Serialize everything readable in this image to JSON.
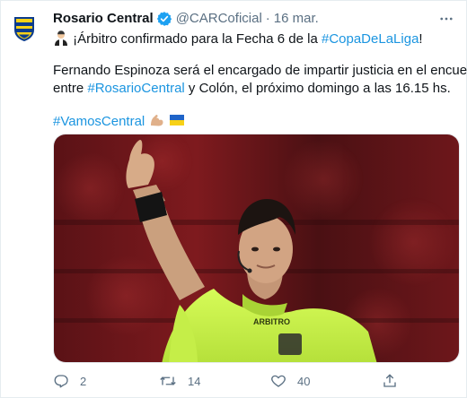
{
  "tweet": {
    "author_name": "Rosario Central",
    "handle": "@CARCoficial",
    "separator": "·",
    "date": "16 mar.",
    "line1_prefix": "¡Árbitro confirmado para la Fecha 6 de la ",
    "line1_hashtag": "#CopaDeLaLiga",
    "line1_suffix": "!",
    "line2": "Fernando Espinoza será el encargado de impartir justicia en el encuentro",
    "line3_prefix": "entre ",
    "line3_hashtag": "#RosarioCentral",
    "line3_suffix": " y Colón, el próximo domingo a las 16.15 hs.",
    "line4_hashtag": "#VamosCentral",
    "vest_text": "ARBITRO"
  },
  "icons": {
    "avatar": "rosario-central-crest",
    "verified": "verified-badge-icon",
    "more": "more-options-icon",
    "whistle_emoji": "referee-emoji",
    "muscle_emoji": "flexed-biceps-emoji",
    "flag_emoji": "blue-yellow-flag-emoji"
  },
  "stats": {
    "replies": "2",
    "retweets": "14",
    "likes": "40"
  },
  "colors": {
    "link": "#1b95e0",
    "muted": "#5b7083",
    "verified": "#1da1f2",
    "referee_shirt": "#c8f04a"
  }
}
